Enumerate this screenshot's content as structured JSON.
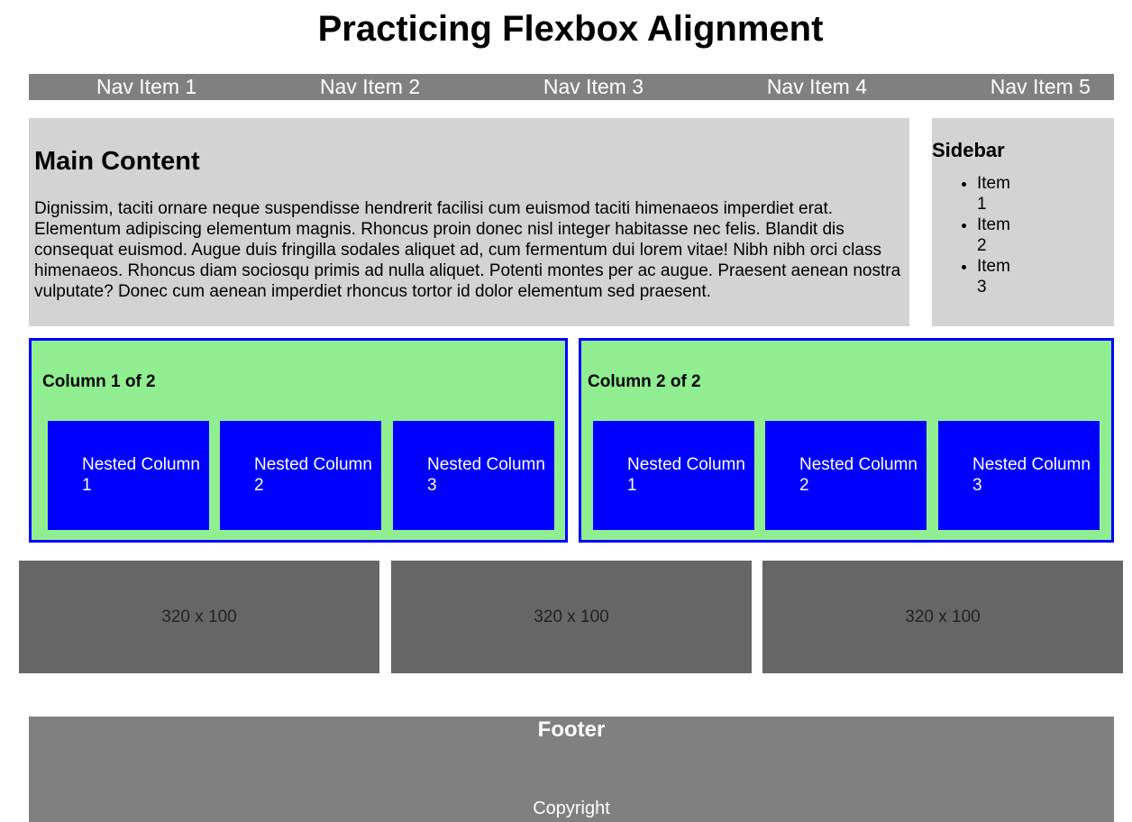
{
  "page": {
    "title": "Practicing Flexbox Alignment"
  },
  "nav": {
    "items": [
      "Nav Item 1",
      "Nav Item 2",
      "Nav Item 3",
      "Nav Item 4",
      "Nav Item 5"
    ]
  },
  "main": {
    "heading": "Main Content",
    "paragraph": "Dignissim, taciti ornare neque suspendisse hendrerit facilisi cum euismod taciti himenaeos imperdiet erat. Elementum adipiscing elementum magnis. Rhoncus proin donec nisl integer habitasse nec felis. Blandit dis consequat euismod. Augue duis fringilla sodales aliquet ad, cum fermentum dui lorem vitae! Nibh nibh orci class himenaeos. Rhoncus diam sociosqu primis ad nulla aliquet. Potenti montes per ac augue. Praesent aenean nostra vulputate? Donec cum aenean imperdiet rhoncus tortor id dolor elementum sed praesent."
  },
  "sidebar": {
    "heading": "Sidebar",
    "items": [
      "Item 1",
      "Item 2",
      "Item 3"
    ]
  },
  "columns": [
    {
      "heading": "Column 1 of 2",
      "nested": [
        "Nested Column 1",
        "Nested Column 2",
        "Nested Column 3"
      ]
    },
    {
      "heading": "Column 2 of 2",
      "nested": [
        "Nested Column 1",
        "Nested Column 2",
        "Nested Column 3"
      ]
    }
  ],
  "placeholders": [
    "320 x 100",
    "320 x 100",
    "320 x 100"
  ],
  "footer": {
    "heading": "Footer",
    "copyright": "Copyright"
  },
  "colors": {
    "nav_bg": "#808080",
    "panel_bg": "#d3d3d3",
    "column_bg": "#90ee90",
    "column_border": "#0000ff",
    "nested_bg": "#0000ff",
    "placeholder_bg": "#666666",
    "footer_bg": "#808080"
  }
}
